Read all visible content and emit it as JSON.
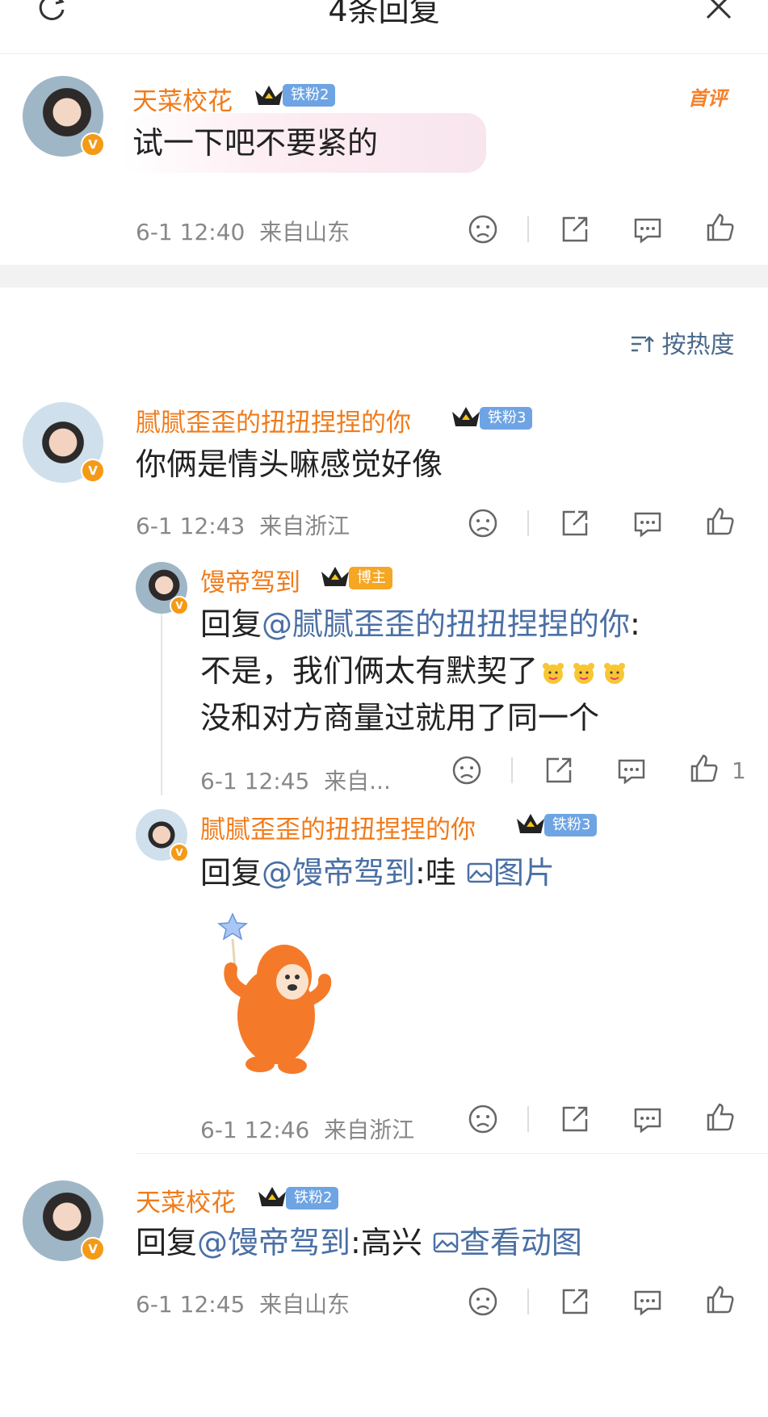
{
  "header": {
    "title": "4条回复"
  },
  "sort_label": "按热度",
  "comments": [
    {
      "user": "天菜校花",
      "fan": "铁粉2",
      "first_tag": "首评",
      "text": "试一下吧不要紧的",
      "time": "6-1 12:40",
      "loc": "来自山东",
      "likes": ""
    },
    {
      "user": "腻腻歪歪的扭扭捏捏的你",
      "fan": "铁粉3",
      "text": "你俩是情头嘛感觉好像",
      "time": "6-1 12:43",
      "loc": "来自浙江",
      "likes": ""
    },
    {
      "user": "馒帝驾到",
      "fan": "博主",
      "reply_prefix": "回复",
      "reply_to": "@腻腻歪歪的扭扭捏捏的你",
      "colon": ":",
      "line2": "不是，我们俩太有默契了",
      "line3": "没和对方商量过就用了同一个",
      "time": "6-1 12:45",
      "loc": "来自...",
      "likes": "1"
    },
    {
      "user": "腻腻歪歪的扭扭捏捏的你",
      "fan": "铁粉3",
      "reply_prefix": "回复",
      "reply_to": "@馒帝驾到",
      "after": ":哇 ",
      "img_label": "图片",
      "time": "6-1 12:46",
      "loc": "来自浙江",
      "likes": ""
    },
    {
      "user": "天菜校花",
      "fan": "铁粉2",
      "reply_prefix": "回复",
      "reply_to": "@馒帝驾到",
      "after": ":高兴 ",
      "img_label": "查看动图",
      "time": "6-1 12:45",
      "loc": "来自山东",
      "likes": ""
    }
  ],
  "colors": {
    "username": "#f07b1a",
    "link": "#4a6fa5",
    "fan_badge": "#6ea4e3",
    "owner_badge": "#f5a623",
    "meta": "#888888"
  }
}
